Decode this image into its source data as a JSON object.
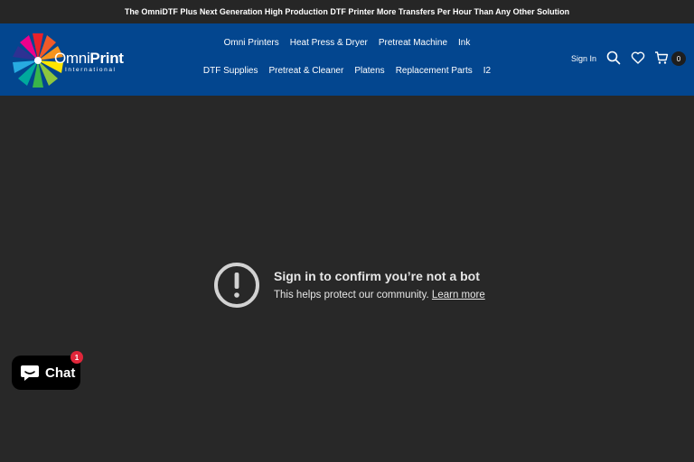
{
  "announcement": {
    "text": "The OmniDTF Plus Next Generation High Production DTF Printer More Transfers Per Hour Than Any Other Solution"
  },
  "header": {
    "logo": {
      "brand_part1": "Omni",
      "brand_part2": "Print",
      "tagline": "International"
    },
    "nav_row1": [
      "Omni Printers",
      "Heat Press & Dryer",
      "Pretreat Machine",
      "Ink"
    ],
    "nav_row2": [
      "DTF Supplies",
      "Pretreat & Cleaner",
      "Platens",
      "Replacement Parts",
      "I2"
    ],
    "sign_in": "Sign In",
    "cart_count": "0",
    "icons": {
      "search": "search-icon",
      "wishlist": "heart-icon",
      "cart": "cart-icon"
    },
    "color": "#03468f"
  },
  "notice": {
    "title": "Sign in to confirm you’re not a bot",
    "message": "This helps protect our community.",
    "link": "Learn more",
    "icon": "exclamation-circle-icon"
  },
  "chat": {
    "label": "Chat",
    "badge": "1",
    "icon": "chat-bubble-icon",
    "badge_color": "#e0263a"
  }
}
